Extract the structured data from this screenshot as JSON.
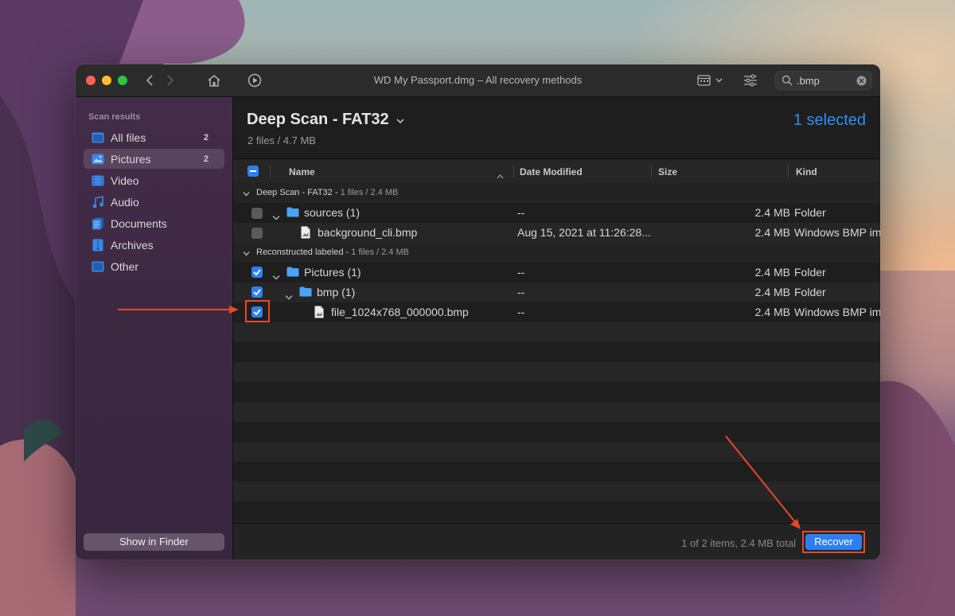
{
  "window": {
    "title": "WD My Passport.dmg – All recovery methods",
    "search": {
      "value": ".bmp",
      "placeholder": ""
    }
  },
  "sidebar": {
    "heading": "Scan results",
    "items": [
      {
        "label": "All files",
        "count": "2",
        "icon": "all-files-icon",
        "active": false
      },
      {
        "label": "Pictures",
        "count": "2",
        "icon": "pictures-icon",
        "active": true
      },
      {
        "label": "Video",
        "count": "",
        "icon": "video-icon",
        "active": false
      },
      {
        "label": "Audio",
        "count": "",
        "icon": "audio-icon",
        "active": false
      },
      {
        "label": "Documents",
        "count": "",
        "icon": "documents-icon",
        "active": false
      },
      {
        "label": "Archives",
        "count": "",
        "icon": "archives-icon",
        "active": false
      },
      {
        "label": "Other",
        "count": "",
        "icon": "other-icon",
        "active": false
      }
    ],
    "show_in_finder": "Show in Finder"
  },
  "main": {
    "scan_title": "Deep Scan - FAT32",
    "scan_summary": "2 files / 4.7 MB",
    "selected_label": "1 selected",
    "columns": {
      "name": "Name",
      "date": "Date Modified",
      "size": "Size",
      "kind": "Kind"
    },
    "groups": [
      {
        "title": "Deep Scan - FAT32",
        "summary": "1 files / 2.4 MB",
        "rows": [
          {
            "name": "sources (1)",
            "date": "--",
            "size": "2.4 MB",
            "kind": "Folder",
            "checked": false,
            "type": "folder"
          },
          {
            "name": "background_cli.bmp",
            "date": "Aug 15, 2021 at 11:26:28...",
            "size": "2.4 MB",
            "kind": "Windows BMP im",
            "checked": false,
            "type": "file"
          }
        ]
      },
      {
        "title": "Reconstructed labeled",
        "summary": "1 files / 2.4 MB",
        "rows": [
          {
            "name": "Pictures (1)",
            "date": "--",
            "size": "2.4 MB",
            "kind": "Folder",
            "checked": true,
            "type": "folder"
          },
          {
            "name": "bmp (1)",
            "date": "--",
            "size": "2.4 MB",
            "kind": "Folder",
            "checked": true,
            "type": "folder"
          },
          {
            "name": "file_1024x768_000000.bmp",
            "date": "--",
            "size": "2.4 MB",
            "kind": "Windows BMP im",
            "checked": true,
            "type": "file"
          }
        ]
      }
    ],
    "footer_status": "1 of 2 items, 2.4 MB total",
    "recover_label": "Recover"
  },
  "colors": {
    "accent": "#2d7ff0",
    "selected_text": "#2f8ff5",
    "annotation": "#e8472a",
    "close": "#ff5f57",
    "minimize": "#febc2e",
    "zoom": "#28c840"
  }
}
